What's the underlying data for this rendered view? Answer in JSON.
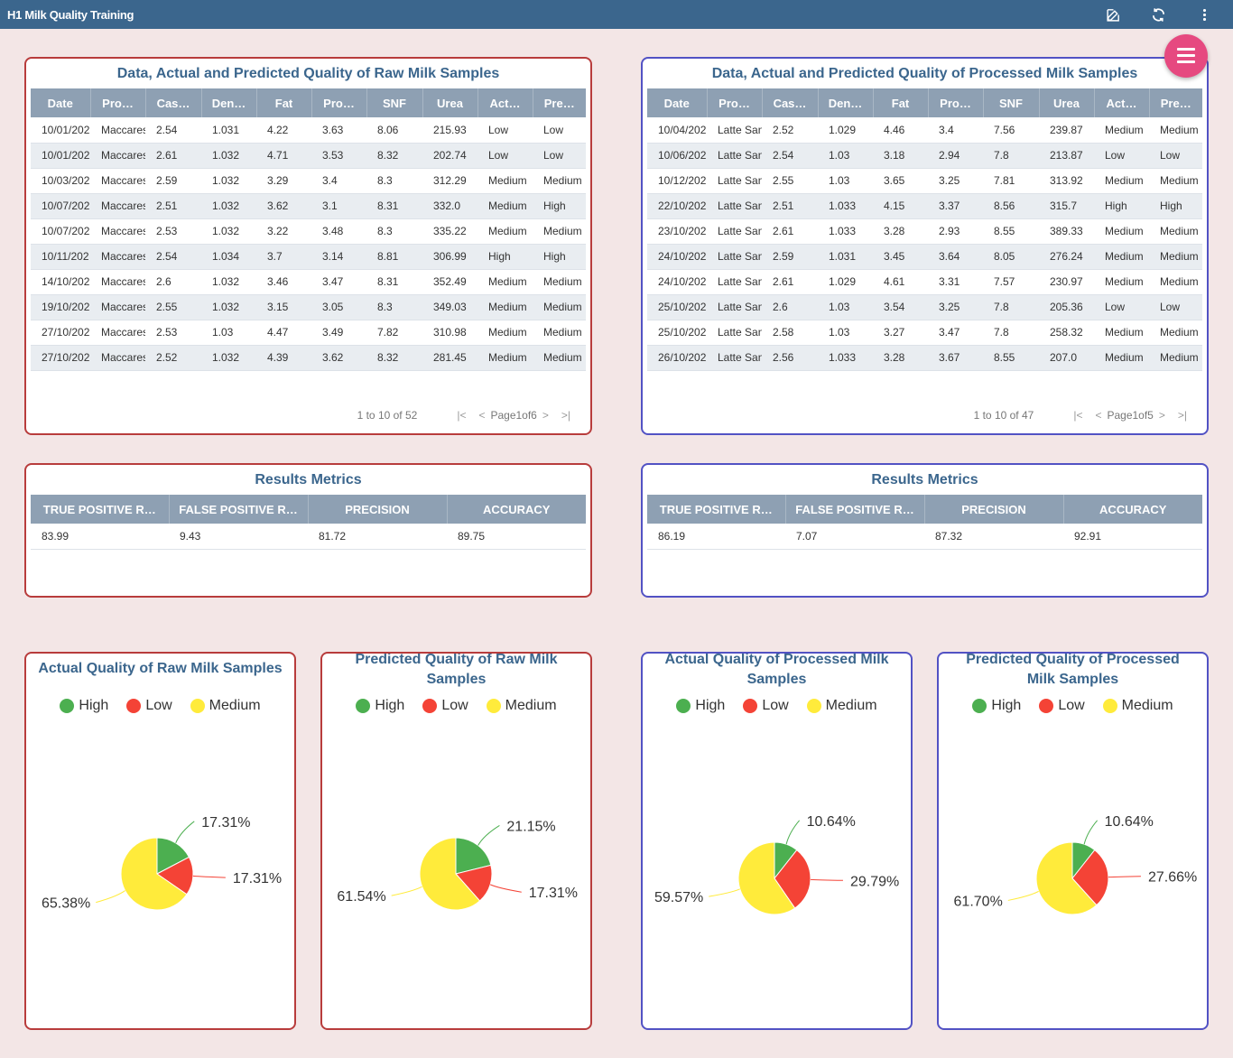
{
  "app": {
    "title": "H1 Milk Quality Training"
  },
  "colors": {
    "topbar": "#3b668d",
    "fab": "#e64980",
    "raw_border": "#b83c3c",
    "processed_border": "#5252c4",
    "high": "#4caf50",
    "low": "#f44336",
    "medium": "#ffeb3b"
  },
  "icons": {
    "edit": "edit-icon",
    "refresh": "refresh-icon",
    "more": "more-vert-icon",
    "menu": "hamburger-menu-icon"
  },
  "raw_table": {
    "title": "Data, Actual and Predicted Quality of Raw Milk Samples",
    "columns": [
      "Date",
      "Pro…",
      "Cas…",
      "Den…",
      "Fat",
      "Pro…",
      "SNF",
      "Urea",
      "Act…",
      "Pre…"
    ],
    "rows": [
      [
        "10/01/202",
        "Maccares",
        "2.54",
        "1.031",
        "4.22",
        "3.63",
        "8.06",
        "215.93",
        "Low",
        "Low"
      ],
      [
        "10/01/202",
        "Maccares",
        "2.61",
        "1.032",
        "4.71",
        "3.53",
        "8.32",
        "202.74",
        "Low",
        "Low"
      ],
      [
        "10/03/202",
        "Maccares",
        "2.59",
        "1.032",
        "3.29",
        "3.4",
        "8.3",
        "312.29",
        "Medium",
        "Medium"
      ],
      [
        "10/07/202",
        "Maccares",
        "2.51",
        "1.032",
        "3.62",
        "3.1",
        "8.31",
        "332.0",
        "Medium",
        "High"
      ],
      [
        "10/07/202",
        "Maccares",
        "2.53",
        "1.032",
        "3.22",
        "3.48",
        "8.3",
        "335.22",
        "Medium",
        "Medium"
      ],
      [
        "10/11/202",
        "Maccares",
        "2.54",
        "1.034",
        "3.7",
        "3.14",
        "8.81",
        "306.99",
        "High",
        "High"
      ],
      [
        "14/10/202",
        "Maccares",
        "2.6",
        "1.032",
        "3.46",
        "3.47",
        "8.31",
        "352.49",
        "Medium",
        "Medium"
      ],
      [
        "19/10/202",
        "Maccares",
        "2.55",
        "1.032",
        "3.15",
        "3.05",
        "8.3",
        "349.03",
        "Medium",
        "Medium"
      ],
      [
        "27/10/202",
        "Maccares",
        "2.53",
        "1.03",
        "4.47",
        "3.49",
        "7.82",
        "310.98",
        "Medium",
        "Medium"
      ],
      [
        "27/10/202",
        "Maccares",
        "2.52",
        "1.032",
        "4.39",
        "3.62",
        "8.32",
        "281.45",
        "Medium",
        "Medium"
      ]
    ],
    "pager": {
      "range": "1 to 10 of 52",
      "page": "Page1of6"
    }
  },
  "processed_table": {
    "title": "Data, Actual and Predicted Quality of Processed Milk Samples",
    "columns": [
      "Date",
      "Pro…",
      "Cas…",
      "Den…",
      "Fat",
      "Pro…",
      "SNF",
      "Urea",
      "Act…",
      "Pre…"
    ],
    "rows": [
      [
        "10/04/202",
        "Latte San",
        "2.52",
        "1.029",
        "4.46",
        "3.4",
        "7.56",
        "239.87",
        "Medium",
        "Medium"
      ],
      [
        "10/06/202",
        "Latte San",
        "2.54",
        "1.03",
        "3.18",
        "2.94",
        "7.8",
        "213.87",
        "Low",
        "Low"
      ],
      [
        "10/12/202",
        "Latte San",
        "2.55",
        "1.03",
        "3.65",
        "3.25",
        "7.81",
        "313.92",
        "Medium",
        "Medium"
      ],
      [
        "22/10/202",
        "Latte San",
        "2.51",
        "1.033",
        "4.15",
        "3.37",
        "8.56",
        "315.7",
        "High",
        "High"
      ],
      [
        "23/10/202",
        "Latte San",
        "2.61",
        "1.033",
        "3.28",
        "2.93",
        "8.55",
        "389.33",
        "Medium",
        "Medium"
      ],
      [
        "24/10/202",
        "Latte San",
        "2.59",
        "1.031",
        "3.45",
        "3.64",
        "8.05",
        "276.24",
        "Medium",
        "Medium"
      ],
      [
        "24/10/202",
        "Latte San",
        "2.61",
        "1.029",
        "4.61",
        "3.31",
        "7.57",
        "230.97",
        "Medium",
        "Medium"
      ],
      [
        "25/10/202",
        "Latte San",
        "2.6",
        "1.03",
        "3.54",
        "3.25",
        "7.8",
        "205.36",
        "Low",
        "Low"
      ],
      [
        "25/10/202",
        "Latte San",
        "2.58",
        "1.03",
        "3.27",
        "3.47",
        "7.8",
        "258.32",
        "Medium",
        "Medium"
      ],
      [
        "26/10/202",
        "Latte San",
        "2.56",
        "1.033",
        "3.28",
        "3.67",
        "8.55",
        "207.0",
        "Medium",
        "Medium"
      ]
    ],
    "pager": {
      "range": "1 to 10 of 47",
      "page": "Page1of5"
    }
  },
  "raw_metrics": {
    "title": "Results Metrics",
    "columns": [
      "TRUE POSITIVE R…",
      "FALSE POSITIVE R…",
      "PRECISION",
      "ACCURACY"
    ],
    "values": [
      "83.99",
      "9.43",
      "81.72",
      "89.75"
    ]
  },
  "processed_metrics": {
    "title": "Results Metrics",
    "columns": [
      "TRUE POSITIVE R…",
      "FALSE POSITIVE R…",
      "PRECISION",
      "ACCURACY"
    ],
    "values": [
      "86.19",
      "7.07",
      "87.32",
      "92.91"
    ]
  },
  "legend": {
    "high": "High",
    "low": "Low",
    "medium": "Medium"
  },
  "chart_data": [
    {
      "type": "pie",
      "title": "Actual Quality of Raw Milk Samples",
      "categories": [
        "High",
        "Low",
        "Medium"
      ],
      "values": [
        17.31,
        17.31,
        65.38
      ],
      "labels": [
        "17.31%",
        "17.31%",
        "65.38%"
      ],
      "legend": "top"
    },
    {
      "type": "pie",
      "title": "Predicted Quality of Raw Milk Samples",
      "categories": [
        "High",
        "Low",
        "Medium"
      ],
      "values": [
        21.15,
        17.31,
        61.54
      ],
      "labels": [
        "21.15%",
        "17.31%",
        "61.54%"
      ],
      "legend": "top"
    },
    {
      "type": "pie",
      "title": "Actual Quality of Processed Milk Samples",
      "categories": [
        "High",
        "Low",
        "Medium"
      ],
      "values": [
        10.64,
        29.79,
        59.57
      ],
      "labels": [
        "10.64%",
        "29.79%",
        "59.57%"
      ],
      "legend": "top"
    },
    {
      "type": "pie",
      "title": "Predicted Quality of Processed Milk Samples",
      "categories": [
        "High",
        "Low",
        "Medium"
      ],
      "values": [
        10.64,
        27.66,
        61.7
      ],
      "labels": [
        "10.64%",
        "27.66%",
        "61.70%"
      ],
      "legend": "top"
    }
  ]
}
